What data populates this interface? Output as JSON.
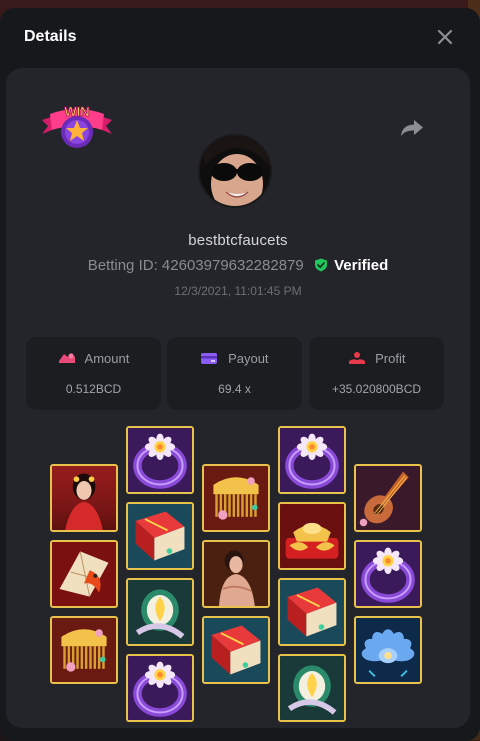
{
  "dialog": {
    "title": "Details"
  },
  "win_badge": {
    "text": "WIN"
  },
  "user": {
    "name": "bestbtcfaucets",
    "betting_label": "Betting ID:",
    "betting_id": "426039796322828­79",
    "verified_label": "Verified",
    "timestamp": "12/3/2021, 11:01:45 PM"
  },
  "stats": {
    "amount": {
      "label": "Amount",
      "value": "0.512BCD"
    },
    "payout": {
      "label": "Payout",
      "value": "69.4 x"
    },
    "profit": {
      "label": "Profit",
      "value": "+35.020800BCD"
    }
  },
  "colors": {
    "tile_border": "#e8c24a",
    "verified_green": "#22c55e",
    "amount_icon": "#e84a7a",
    "payout_icon": "#8b5cf6",
    "profit_icon": "#e83a4a"
  },
  "reels": [
    [
      "lady-red",
      "fan-koi",
      "comb-gold"
    ],
    [
      "ring-flower",
      "book-red",
      "mirror-jade",
      "ring-flower"
    ],
    [
      "comb-gold",
      "lady-bath",
      "book-red"
    ],
    [
      "ring-flower",
      "gold-ingot",
      "book-red",
      "mirror-jade"
    ],
    [
      "pipa-instrument",
      "ring-flower",
      "lotus-blue"
    ]
  ]
}
